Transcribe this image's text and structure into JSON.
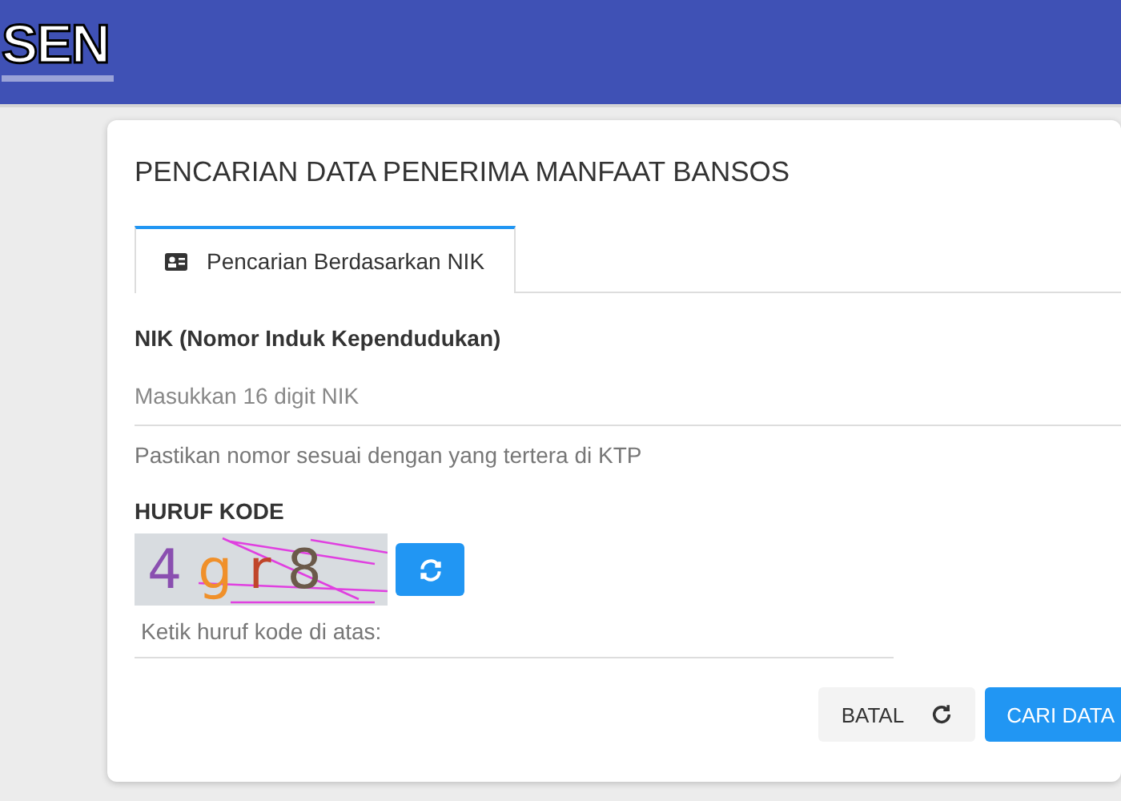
{
  "logo": {
    "text": "SEN"
  },
  "title": "PENCARIAN DATA PENERIMA MANFAAT BANSOS",
  "tabs": [
    {
      "label": "Pencarian Berdasarkan NIK",
      "selected": true
    }
  ],
  "nik": {
    "label": "NIK (Nomor Induk Kependudukan)",
    "placeholder": "Masukkan 16 digit NIK",
    "hint": "Pastikan nomor sesuai dengan yang tertera di KTP"
  },
  "captcha": {
    "label": "HURUF KODE",
    "chars": [
      {
        "text": "4",
        "color": "#8a4fb0"
      },
      {
        "text": "g",
        "color": "#f0902a"
      },
      {
        "text": "r",
        "color": "#c0452a"
      },
      {
        "text": "8",
        "color": "#6b5a4a"
      }
    ],
    "placeholder": "Ketik huruf kode di atas:"
  },
  "buttons": [
    {
      "label": "BATAL",
      "kind": "reset"
    },
    {
      "label": "CARI DATA",
      "kind": "primary"
    }
  ]
}
